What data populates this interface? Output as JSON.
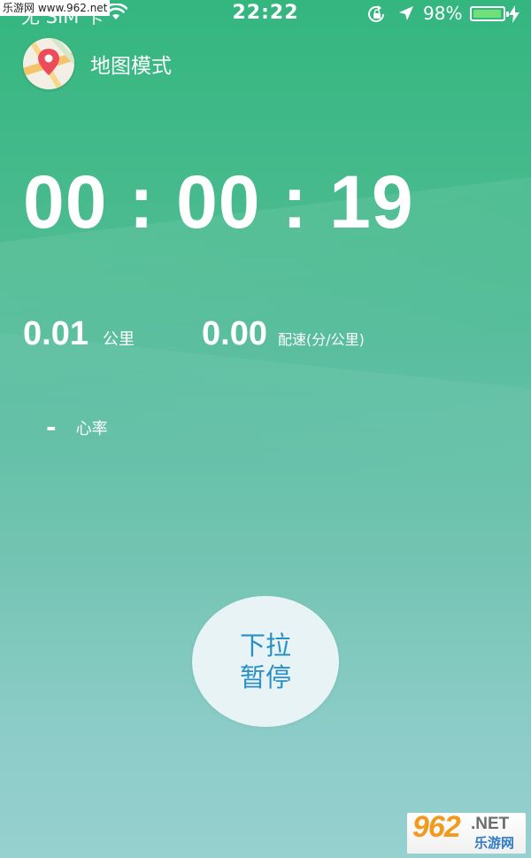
{
  "watermark_top": "乐游网 www.962.net",
  "status_bar": {
    "carrier": "无 SIM 卡",
    "time": "22:22",
    "battery_percent": "98%",
    "battery_level": 0.98,
    "icons": [
      "wifi-icon",
      "rotation-lock-icon",
      "location-arrow-icon",
      "battery-icon",
      "charging-icon"
    ]
  },
  "header": {
    "map_mode_label": "地图模式",
    "icon": "map-pin-icon"
  },
  "timer": {
    "elapsed": "00 : 00 : 19"
  },
  "stats": {
    "distance_value": "0.01",
    "distance_unit": "公里",
    "pace_value": "0.00",
    "pace_unit": "配速(分/公里)"
  },
  "heart_rate": {
    "value": "-",
    "label": "心率"
  },
  "pause_button": {
    "line1": "下拉",
    "line2": "暂停"
  },
  "watermark_logo": {
    "number": "962",
    "net": ".NET",
    "chinese": "乐游网"
  },
  "colors": {
    "bg_top": "#34b67f",
    "bg_bottom": "#96d0cf",
    "button_bg": "#e7f3f4",
    "button_text": "#2a8fc8",
    "battery_fill": "#6fe07a"
  }
}
